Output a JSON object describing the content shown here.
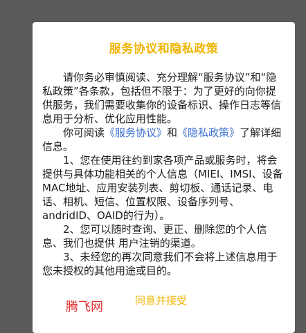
{
  "dialog": {
    "title": "服务协议和隐私政策",
    "para1": "请你务必审慎阅读、充分理解“服务协议”和“隐私政策”各条款，包括但不限于：为了更好的向你提供服务，我们需要收集你的设备标识、操作日志等信息用于分析、优化应用性能。",
    "para2_prefix": "你可阅读",
    "link_service": "《服务协议》",
    "para2_and": "和",
    "link_privacy": "《隐私政策》",
    "para2_suffix": "了解详细信息。",
    "para3": "1、您在使用往约到家各项产品或服务时，将会提供与具体功能相关的个人信息（MIEI、IMSI、设备MAC地址、应用安装列表、剪切板、通话记录、电话、相机、短信、位置权限、设备序列号、andridID、OAID的行为）。",
    "para4": "2、您可以随时查询、更正、删除您的个人信息、我们也提供 用户注销的渠道。",
    "para5": "3、未经您的再次同意我们不会将上述信息用于您未授权的其他用途或目的。"
  },
  "buttons": {
    "reject_label": "腾飞网",
    "accept_label": "同意并接受"
  },
  "colors": {
    "title": "#f0b400",
    "link": "#3a6fd0",
    "reject": "#e03030",
    "overlay": "#5a5a5a"
  }
}
